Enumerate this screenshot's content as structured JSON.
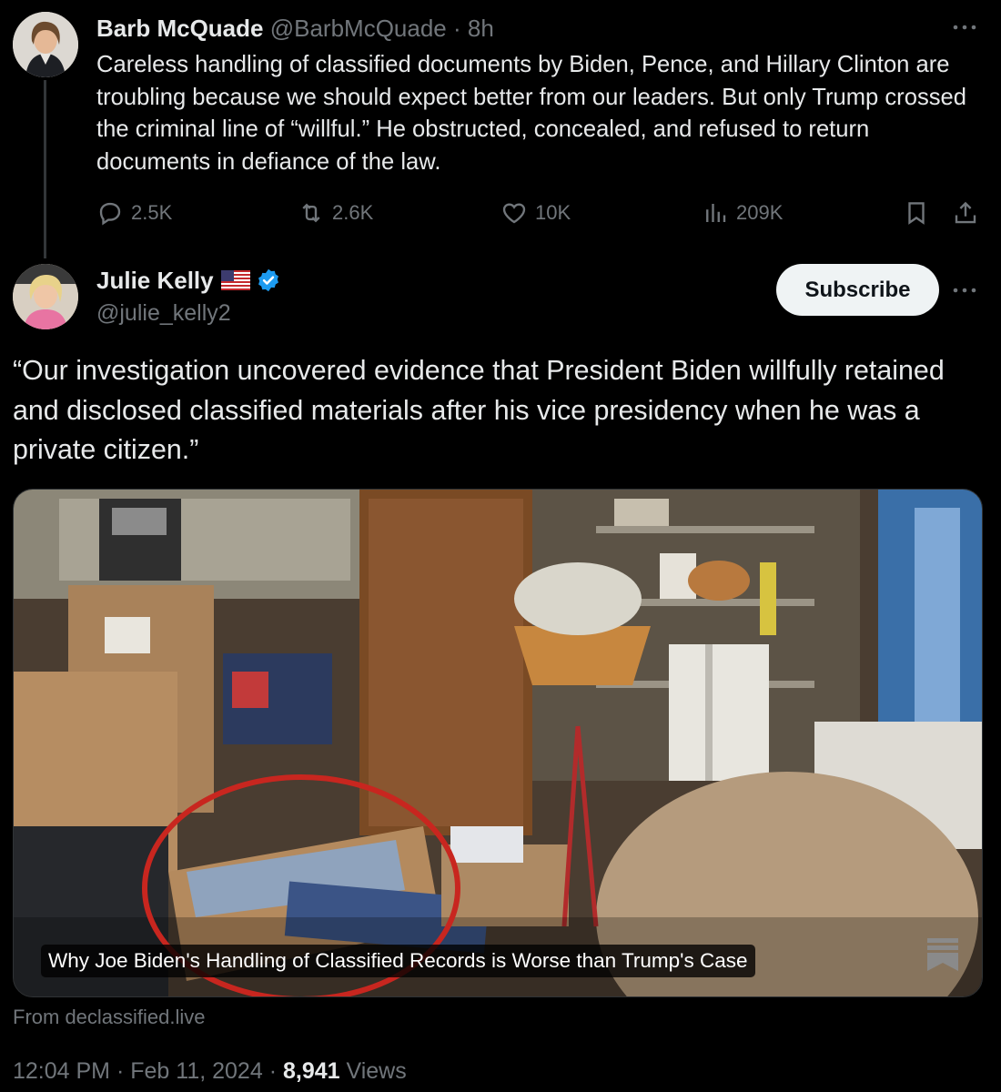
{
  "parent_tweet": {
    "author_name": "Barb McQuade",
    "author_handle": "@BarbMcQuade",
    "separator": "·",
    "time_ago": "8h",
    "text": "Careless handling of classified documents by Biden, Pence, and Hillary Clinton are troubling because we should expect better from our leaders. But only Trump crossed the criminal line of “willful.” He obstructed, concealed, and refused to return documents in defiance of the law.",
    "more_icon": "ellipsis-icon",
    "actions": {
      "replies": "2.5K",
      "reposts": "2.6K",
      "likes": "10K",
      "views": "209K"
    }
  },
  "main_tweet": {
    "author_name": "Julie Kelly",
    "flag_icon": "us-flag-icon",
    "verified_icon": "verified-badge-icon",
    "author_handle": "@julie_kelly2",
    "subscribe_label": "Subscribe",
    "text": "“Our investigation uncovered evidence that President Biden willfully retained and disclosed classified materials after his vice presidency when he was a private citizen.”",
    "link_card": {
      "caption": "Why Joe Biden's Handling of Classified Records is Worse than Trump's Case",
      "source": "From declassified.live"
    },
    "time": "12:04 PM",
    "date": "Feb 11, 2024",
    "separator": "·",
    "views_count": "8,941",
    "views_label": "Views"
  },
  "colors": {
    "background": "#000000",
    "text": "#e7e9ea",
    "muted": "#71767b",
    "verified": "#1d9bf0",
    "circle_annotation": "#c8261f"
  }
}
